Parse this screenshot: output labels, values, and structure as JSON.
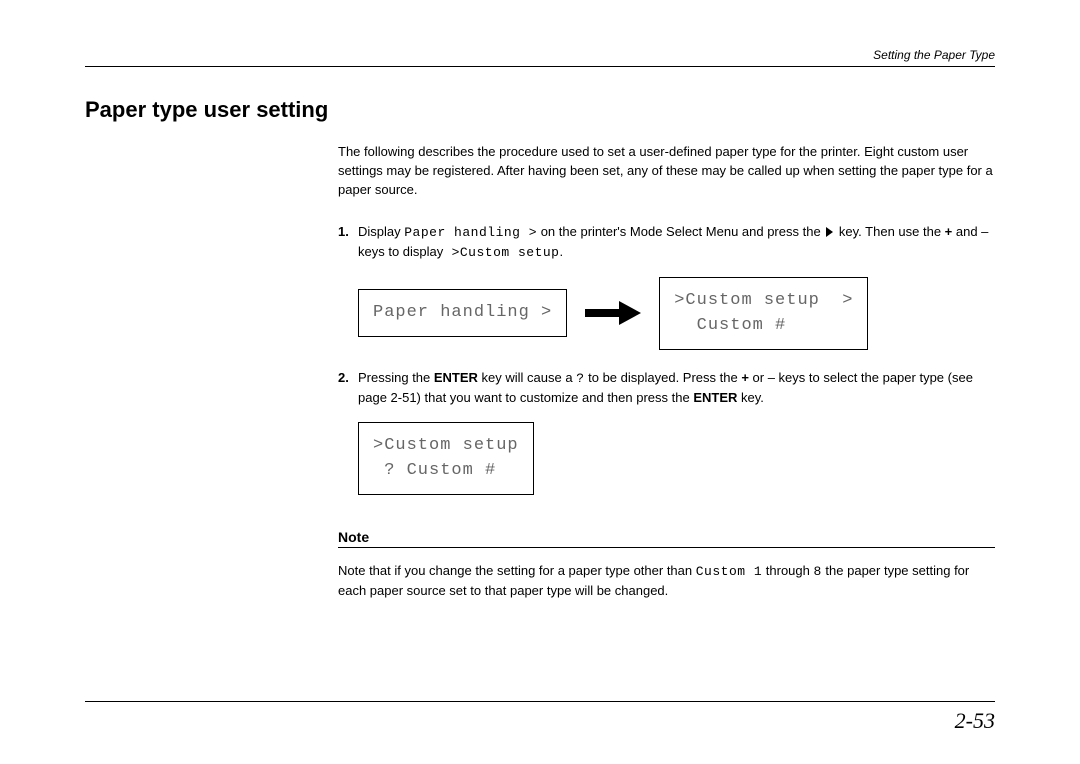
{
  "running_head": "Setting the Paper Type",
  "title": "Paper type user setting",
  "intro": "The following describes the procedure used to set a user-defined paper type for the printer. Eight custom user settings may be registered. After having been set, any of these may be called up when setting the paper type for a paper source.",
  "steps": {
    "s1": {
      "num": "1.",
      "pre1": "Display",
      "mono1": "Paper handling >",
      "mid1": " on the printer's Mode Select Menu and press the ",
      "mid2": " key. Then use the ",
      "bold_plus": "+",
      "mid3": " and – keys to display",
      "mono2": " >Custom setup",
      "period": ".",
      "lcd_a": "Paper handling >",
      "lcd_b_line1": ">Custom setup  >",
      "lcd_b_line2": "  Custom #"
    },
    "s2": {
      "num": "2.",
      "pre1": "Pressing the ",
      "enter": "ENTER",
      "mid1": " key will cause a ",
      "q": "?",
      "mid2": " to be displayed. Press the ",
      "plus": "+",
      "mid3": " or – keys to select the paper type (see page 2-51) that you want to customize and then press the ",
      "mid4": " key.",
      "lcd_line1": ">Custom setup",
      "lcd_line2": " ? Custom #"
    }
  },
  "note": {
    "heading": "Note",
    "pre": "Note that if you change the setting for a paper type other than ",
    "mono1": "Custom 1",
    "mid": " through ",
    "mono2": "8",
    "post": " the paper type setting for each paper source set to that paper type will be changed."
  },
  "page_number": "2-53"
}
